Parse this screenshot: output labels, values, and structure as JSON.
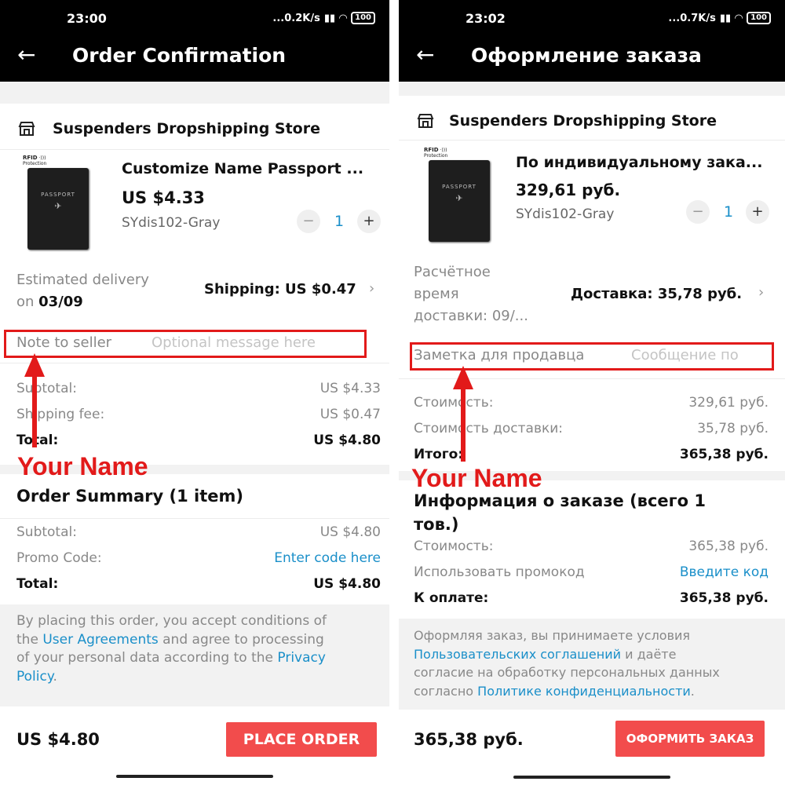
{
  "left": {
    "status": {
      "time": "23:00",
      "speed": "...0.2K/s",
      "battery": "100"
    },
    "header": {
      "title": "Order Confirmation"
    },
    "store": {
      "name": "Suspenders Dropshipping Store"
    },
    "product": {
      "name": "Customize Name Passport ...",
      "price": "US $4.33",
      "sku": "SYdis102-Gray",
      "quantity": "1",
      "image_text": {
        "rfid": "RFID",
        "protection": "Protection",
        "passport": "PASSPORT"
      }
    },
    "delivery": {
      "line1": "Estimated delivery",
      "on": "on ",
      "date": "03/09",
      "shipping_label": "Shipping: US $0.47"
    },
    "note": {
      "label": "Note to seller",
      "placeholder": "Optional message here"
    },
    "costs": {
      "subtotal_label": "Subtotal:",
      "subtotal_value": "US $4.33",
      "shipping_label": "Shipping fee:",
      "shipping_value": "US $0.47",
      "total_label": "Total:",
      "total_value": "US $4.80"
    },
    "annotation": "Your Name",
    "summary": {
      "title": "Order Summary (1 item)",
      "subtotal_label": "Subtotal:",
      "subtotal_value": "US $4.80",
      "promo_label": "Promo Code:",
      "promo_link": "Enter code here",
      "total_label": "Total:",
      "total_value": "US $4.80"
    },
    "legal": {
      "l1": "By placing this order, you accept conditions of",
      "l2_pre": "the ",
      "l2_link": "User Agreements",
      "l2_post": " and agree to processing",
      "l3_pre": "of your personal data according to the ",
      "l3_link": "Privacy",
      "l4_link": "Policy",
      "l4_post": "."
    },
    "bottom": {
      "total": "US $4.80",
      "cta": "PLACE ORDER"
    }
  },
  "right": {
    "status": {
      "time": "23:02",
      "speed": "...0.7K/s",
      "battery": "100"
    },
    "header": {
      "title": "Оформление заказа"
    },
    "store": {
      "name": "Suspenders Dropshipping Store"
    },
    "product": {
      "name": "По индивидуальному зака...",
      "price": "329,61 руб.",
      "sku": "SYdis102-Gray",
      "quantity": "1",
      "image_text": {
        "rfid": "RFID",
        "protection": "Protection",
        "passport": "PASSPORT"
      }
    },
    "delivery": {
      "line1": "Расчётное",
      "line2": "время",
      "line3": "доставки: 09/...",
      "shipping_label": "Доставка: 35,78 руб."
    },
    "note": {
      "label": "Заметка для продавца",
      "placeholder": "Сообщение по"
    },
    "costs": {
      "subtotal_label": "Стоимость:",
      "subtotal_value": "329,61 руб.",
      "shipping_label": "Стоимость доставки:",
      "shipping_value": "35,78 руб.",
      "total_label": "Итого:",
      "total_value": "365,38 руб."
    },
    "annotation": "Your Name",
    "summary": {
      "title_l1": "Информация о заказе (всего 1",
      "title_l2": "тов.)",
      "subtotal_label": "Стоимость:",
      "subtotal_value": "365,38 руб.",
      "promo_label": "Использовать промокод",
      "promo_link": "Введите код",
      "total_label": "К оплате:",
      "total_value": "365,38 руб."
    },
    "legal": {
      "l1": "Оформляя заказ, вы принимаете условия",
      "l2_link": "Пользовательских соглашений",
      "l2_post": " и даёте",
      "l3": "согласие на обработку персональных данных",
      "l4_pre": "согласно ",
      "l4_link": "Политике конфиденциальности",
      "l4_post": "."
    },
    "bottom": {
      "total": "365,38 руб.",
      "cta": "ОФОРМИТЬ ЗАКАЗ"
    }
  }
}
